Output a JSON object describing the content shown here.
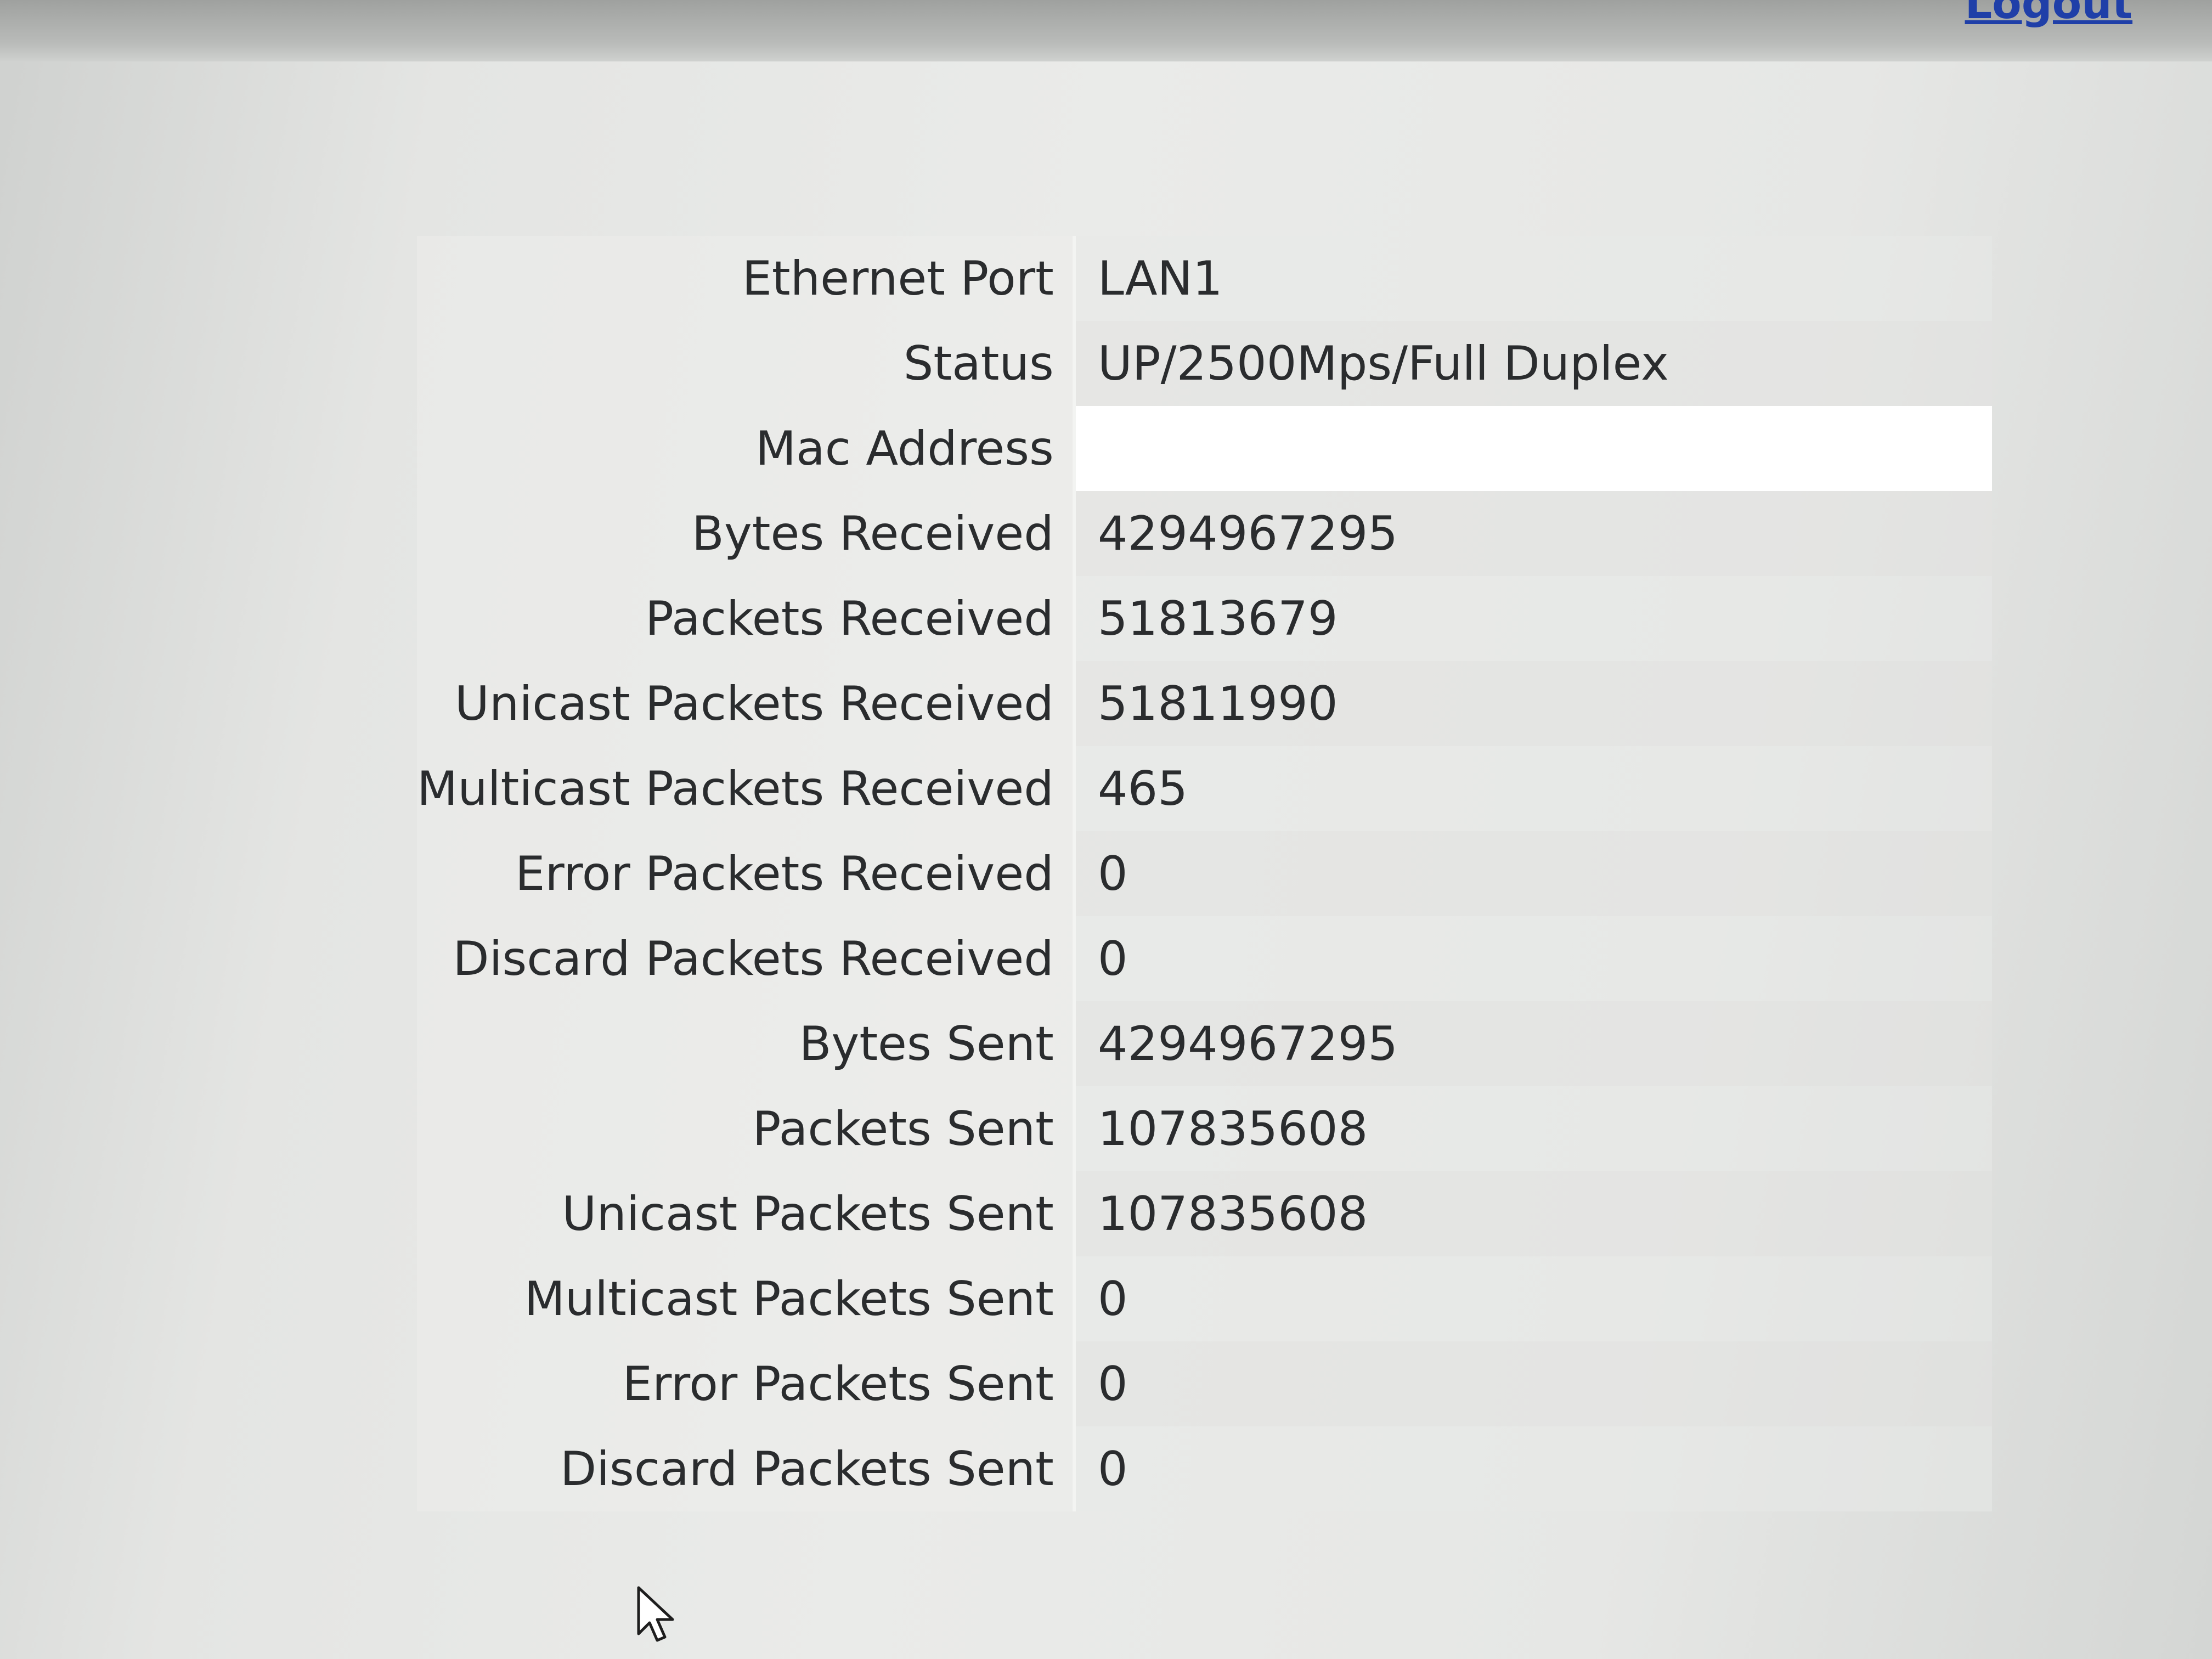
{
  "header": {
    "logout_label": "Logout"
  },
  "ethernet_stats": [
    {
      "label": "Ethernet Port",
      "value": "LAN1"
    },
    {
      "label": "Status",
      "value": "UP/2500Mps/Full Duplex"
    },
    {
      "label": "Mac Address",
      "value": ""
    },
    {
      "label": "Bytes Received",
      "value": "4294967295"
    },
    {
      "label": "Packets Received",
      "value": "51813679"
    },
    {
      "label": "Unicast Packets Received",
      "value": "51811990"
    },
    {
      "label": "Multicast Packets Received",
      "value": "465"
    },
    {
      "label": "Error Packets Received",
      "value": "0"
    },
    {
      "label": "Discard Packets Received",
      "value": "0"
    },
    {
      "label": "Bytes Sent",
      "value": "4294967295"
    },
    {
      "label": "Packets Sent",
      "value": "107835608"
    },
    {
      "label": "Unicast Packets Sent",
      "value": "107835608"
    },
    {
      "label": "Multicast Packets Sent",
      "value": "0"
    },
    {
      "label": "Error Packets Sent",
      "value": "0"
    },
    {
      "label": "Discard Packets Sent",
      "value": "0"
    }
  ],
  "colors": {
    "link": "#1f3fa8",
    "text": "#2a2c2e",
    "background": "#e6e7e5"
  }
}
